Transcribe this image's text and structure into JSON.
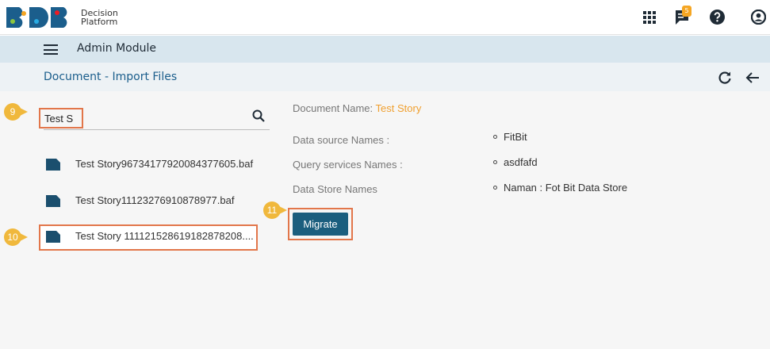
{
  "app": {
    "logo_line1": "Decision",
    "logo_line2": "Platform",
    "notification_count": "5"
  },
  "module": {
    "title": "Admin Module"
  },
  "page": {
    "title": "Document - Import Files"
  },
  "search": {
    "value": "Test S"
  },
  "markers": {
    "search": "9",
    "file": "10",
    "migrate": "11"
  },
  "files": [
    {
      "name": "Test Story96734177920084377605.baf"
    },
    {
      "name": "Test Story11123276910878977.baf"
    },
    {
      "name": "Test Story 111121528619182878208...."
    }
  ],
  "details": {
    "doc_name_label": "Document Name:",
    "doc_name_value": "Test Story",
    "data_source_label": "Data source Names :",
    "data_source_value": "FitBit",
    "query_services_label": "Query services Names :",
    "query_services_value": "asdfafd",
    "data_store_label": "Data Store Names",
    "data_store_value": "Naman : Fot Bit Data Store"
  },
  "actions": {
    "migrate_label": "Migrate"
  },
  "colors": {
    "accent_orange": "#f0a030",
    "callout_yellow": "#f0b83c",
    "highlight_border": "#e2764a",
    "primary_button": "#1b5e7e",
    "module_bar": "#d8e6ee"
  }
}
